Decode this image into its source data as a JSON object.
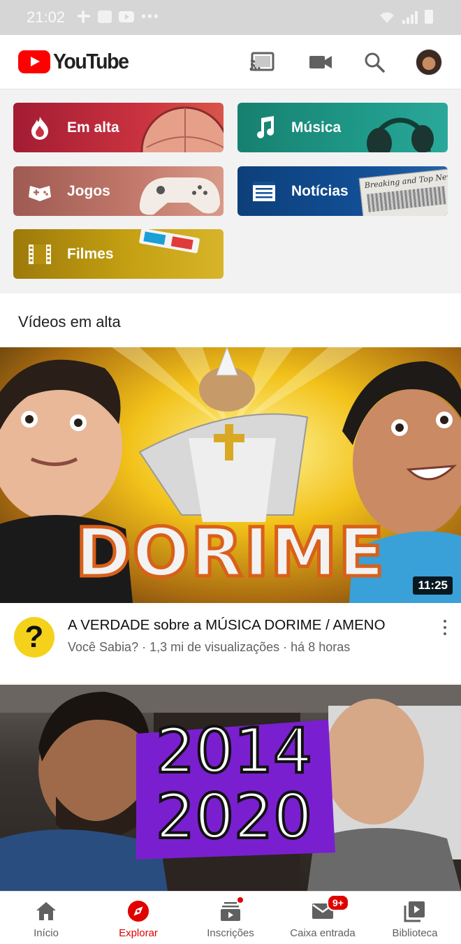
{
  "status_bar": {
    "time": "21:02",
    "left_icons": [
      "slack-icon",
      "gallery-icon",
      "youtube-icon",
      "more-icon"
    ],
    "right_icons": [
      "wifi-icon",
      "signal-icon",
      "battery-icon"
    ]
  },
  "app_bar": {
    "brand": "YouTube",
    "actions": [
      "cast-icon",
      "video-camera-icon",
      "search-icon",
      "avatar"
    ]
  },
  "categories": [
    {
      "label": "Em alta",
      "icon": "trending-icon",
      "color": "#b52633"
    },
    {
      "label": "Música",
      "icon": "music-note-icon",
      "color": "#1b8b7c"
    },
    {
      "label": "Jogos",
      "icon": "gamepad-icon",
      "color": "#a96a5e"
    },
    {
      "label": "Notícias",
      "icon": "news-icon",
      "color": "#0f4b8c"
    },
    {
      "label": "Filmes",
      "icon": "film-icon",
      "color": "#b58a10"
    }
  ],
  "news_deco_text": "Breaking and Top News",
  "section": {
    "title": "Vídeos em alta"
  },
  "videos": [
    {
      "thumbnail_text": "DORIME",
      "duration": "11:25",
      "title": "A VERDADE sobre a MÚSICA DORIME / AMENO",
      "channel": "Você Sabia?",
      "views": "1,3 mi de visualizações",
      "age": "há 8 horas",
      "meta_line": "Você Sabia? · 1,3 mi de visualizações · há 8 horas",
      "avatar_glyph": "?"
    },
    {
      "thumbnail_text_1": "2014",
      "thumbnail_text_2": "2020"
    }
  ],
  "bottom_nav": [
    {
      "label": "Início",
      "icon": "home-icon",
      "active": false
    },
    {
      "label": "Explorar",
      "icon": "explore-compass-icon",
      "active": true
    },
    {
      "label": "Inscrições",
      "icon": "subscriptions-icon",
      "active": false
    },
    {
      "label": "Caixa entrada",
      "icon": "inbox-icon",
      "active": false,
      "badge": "9+"
    },
    {
      "label": "Biblioteca",
      "icon": "library-icon",
      "active": false
    }
  ],
  "colors": {
    "accent": "#ff0000",
    "active_nav": "#e00000"
  }
}
